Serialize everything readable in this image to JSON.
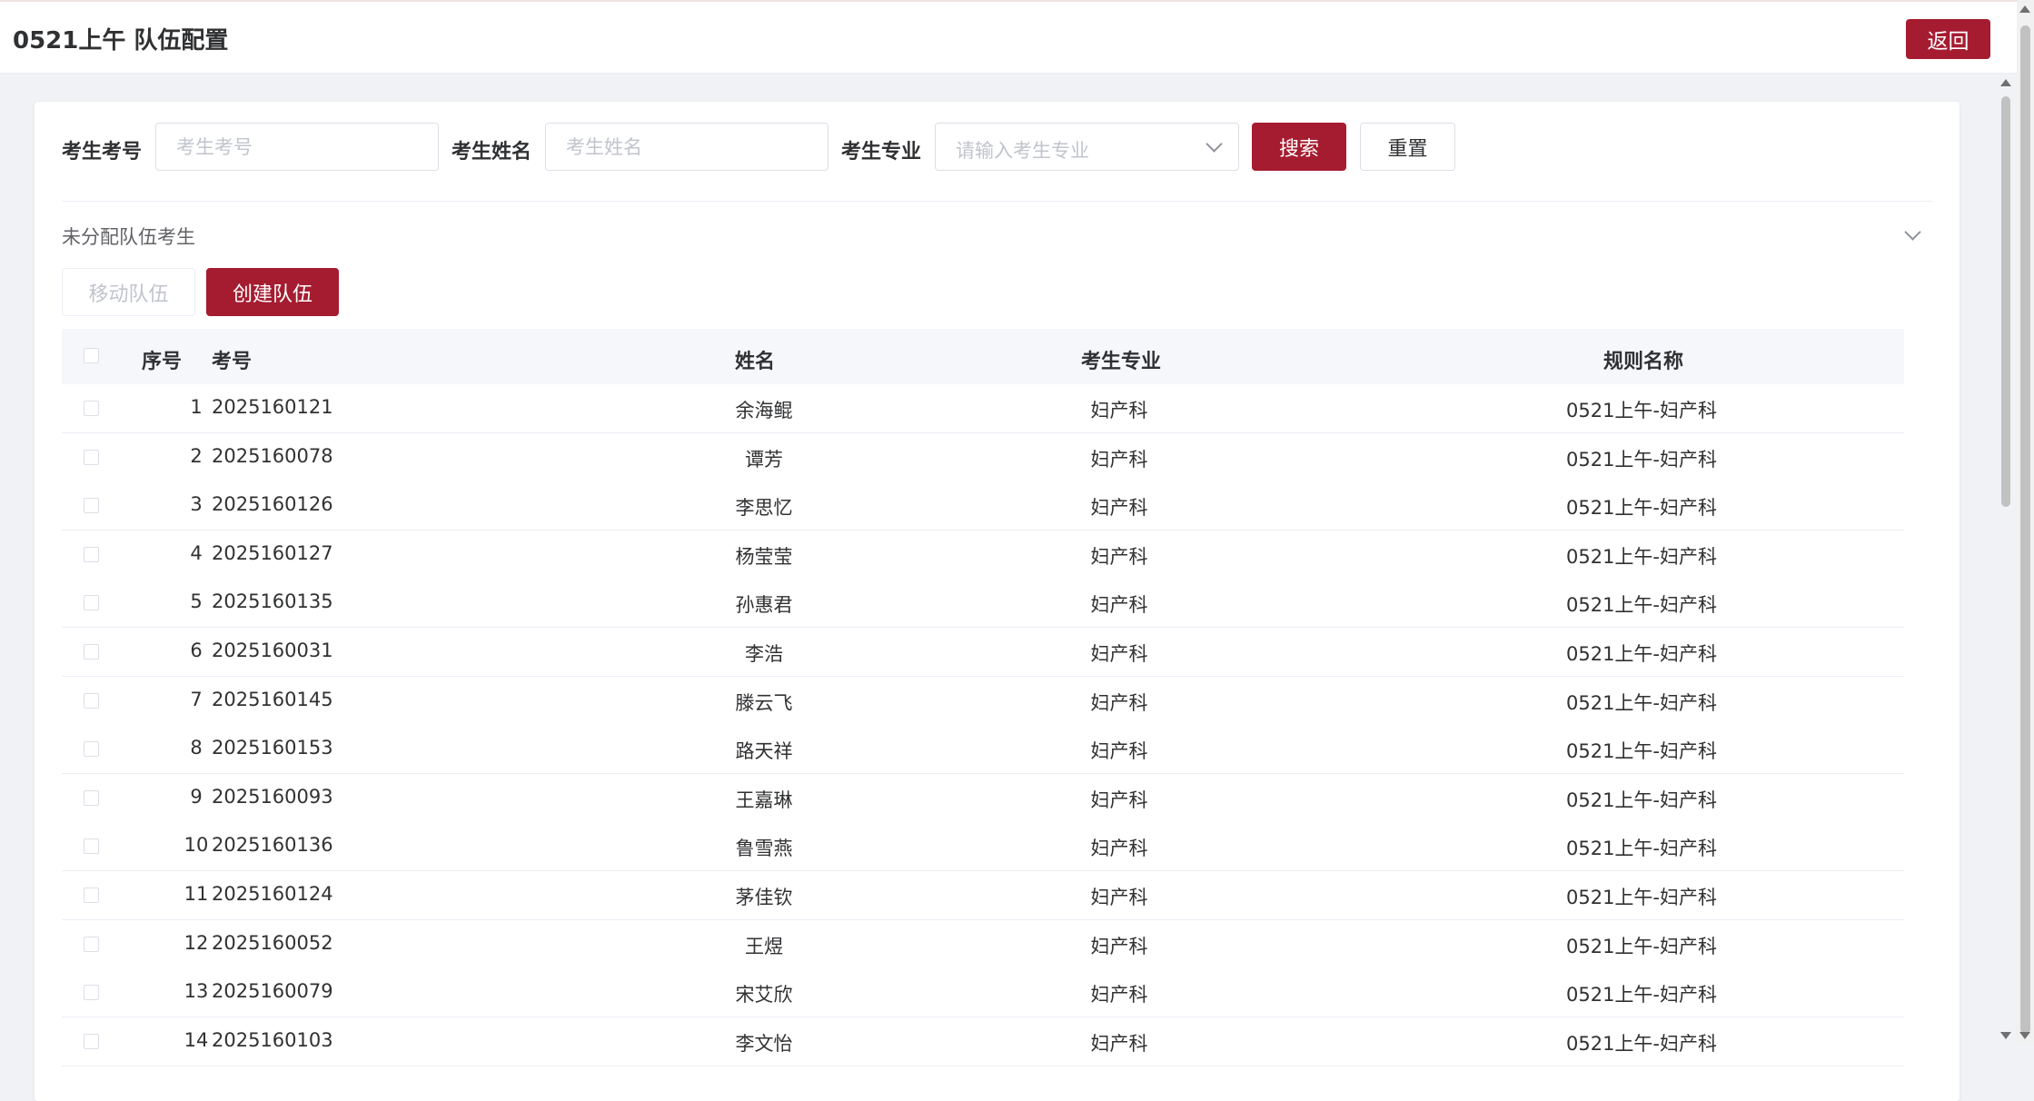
{
  "header": {
    "title": "0521上午 队伍配置",
    "back_label": "返回"
  },
  "search": {
    "exam_no_label": "考生考号",
    "exam_no_placeholder": "考生考号",
    "name_label": "考生姓名",
    "name_placeholder": "考生姓名",
    "major_label": "考生专业",
    "major_placeholder": "请输入考生专业",
    "search_label": "搜索",
    "reset_label": "重置"
  },
  "section": {
    "title": "未分配队伍考生",
    "move_label": "移动队伍",
    "create_label": "创建队伍"
  },
  "table": {
    "columns": [
      "序号",
      "考号",
      "姓名",
      "考生专业",
      "规则名称"
    ],
    "rows": [
      {
        "idx": "1",
        "exam_no": "2025160121",
        "name": "余海鲲",
        "major": "妇产科",
        "rule": "0521上午-妇产科"
      },
      {
        "idx": "2",
        "exam_no": "2025160078",
        "name": "谭芳",
        "major": "妇产科",
        "rule": "0521上午-妇产科"
      },
      {
        "idx": "3",
        "exam_no": "2025160126",
        "name": "李思忆",
        "major": "妇产科",
        "rule": "0521上午-妇产科"
      },
      {
        "idx": "4",
        "exam_no": "2025160127",
        "name": "杨莹莹",
        "major": "妇产科",
        "rule": "0521上午-妇产科"
      },
      {
        "idx": "5",
        "exam_no": "2025160135",
        "name": "孙惠君",
        "major": "妇产科",
        "rule": "0521上午-妇产科"
      },
      {
        "idx": "6",
        "exam_no": "2025160031",
        "name": "李浩",
        "major": "妇产科",
        "rule": "0521上午-妇产科"
      },
      {
        "idx": "7",
        "exam_no": "2025160145",
        "name": "滕云飞",
        "major": "妇产科",
        "rule": "0521上午-妇产科"
      },
      {
        "idx": "8",
        "exam_no": "2025160153",
        "name": "路天祥",
        "major": "妇产科",
        "rule": "0521上午-妇产科"
      },
      {
        "idx": "9",
        "exam_no": "2025160093",
        "name": "王嘉琳",
        "major": "妇产科",
        "rule": "0521上午-妇产科"
      },
      {
        "idx": "10",
        "exam_no": "2025160136",
        "name": "鲁雪燕",
        "major": "妇产科",
        "rule": "0521上午-妇产科"
      },
      {
        "idx": "11",
        "exam_no": "2025160124",
        "name": "茅佳钦",
        "major": "妇产科",
        "rule": "0521上午-妇产科"
      },
      {
        "idx": "12",
        "exam_no": "2025160052",
        "name": "王煜",
        "major": "妇产科",
        "rule": "0521上午-妇产科"
      },
      {
        "idx": "13",
        "exam_no": "2025160079",
        "name": "宋艾欣",
        "major": "妇产科",
        "rule": "0521上午-妇产科"
      },
      {
        "idx": "14",
        "exam_no": "2025160103",
        "name": "李文怡",
        "major": "妇产科",
        "rule": "0521上午-妇产科"
      }
    ]
  },
  "colors": {
    "primary": "#a51c30",
    "border": "#dcdfe6",
    "header_bg": "#f5f7fa"
  }
}
